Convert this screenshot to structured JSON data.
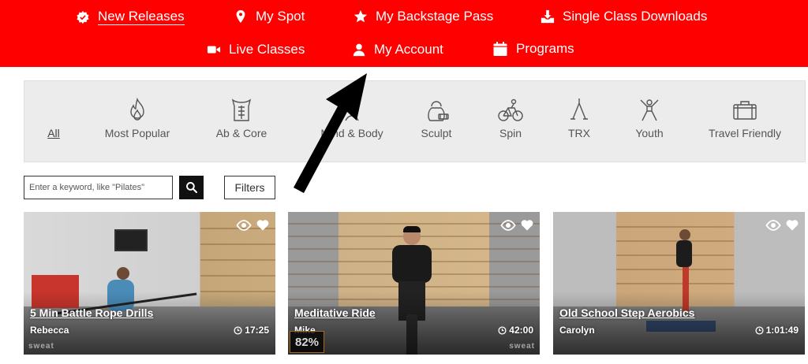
{
  "colors": {
    "nav_bg": "#ff0000",
    "nav_text": "#ffffff",
    "catbar_bg": "#ececec",
    "search_btn_bg": "#111111"
  },
  "nav": {
    "row1": [
      {
        "label": "New Releases",
        "icon": "badge-icon",
        "active": true
      },
      {
        "label": "My Spot",
        "icon": "map-pin-icon"
      },
      {
        "label": "My Backstage Pass",
        "icon": "star-icon"
      },
      {
        "label": "Single Class Downloads",
        "icon": "download-icon"
      }
    ],
    "row2": [
      {
        "label": "Live Classes",
        "icon": "video-camera-icon"
      },
      {
        "label": "My Account",
        "icon": "user-icon"
      },
      {
        "label": "Programs",
        "icon": "calendar-icon"
      }
    ]
  },
  "categories": [
    {
      "label": "All",
      "icon": null,
      "selected": true
    },
    {
      "label": "Most Popular",
      "icon": "flame-icon"
    },
    {
      "label": "Ab & Core",
      "icon": "torso-icon"
    },
    {
      "label": "Mind & Body",
      "icon": "mind-body-icon"
    },
    {
      "label": "Sculpt",
      "icon": "kettlebell-icon"
    },
    {
      "label": "Spin",
      "icon": "bicycle-icon"
    },
    {
      "label": "TRX",
      "icon": "trx-straps-icon"
    },
    {
      "label": "Youth",
      "icon": "jumping-person-icon"
    },
    {
      "label": "Travel Friendly",
      "icon": "suitcase-icon"
    }
  ],
  "search": {
    "placeholder": "Enter a keyword, like \"Pilates\"",
    "value": "",
    "button_icon": "search-icon"
  },
  "filters": {
    "label": "Filters"
  },
  "cards": [
    {
      "title": "5 Min Battle Rope Drills",
      "instructor": "Rebecca",
      "duration": "17:25",
      "brand": "sweat"
    },
    {
      "title": "Meditative Ride",
      "instructor": "Mike",
      "duration": "42:00",
      "progress_label": "82%",
      "brand": "sweat"
    },
    {
      "title": "Old School Step Aerobics",
      "instructor": "Carolyn",
      "duration": "1:01:49"
    }
  ]
}
